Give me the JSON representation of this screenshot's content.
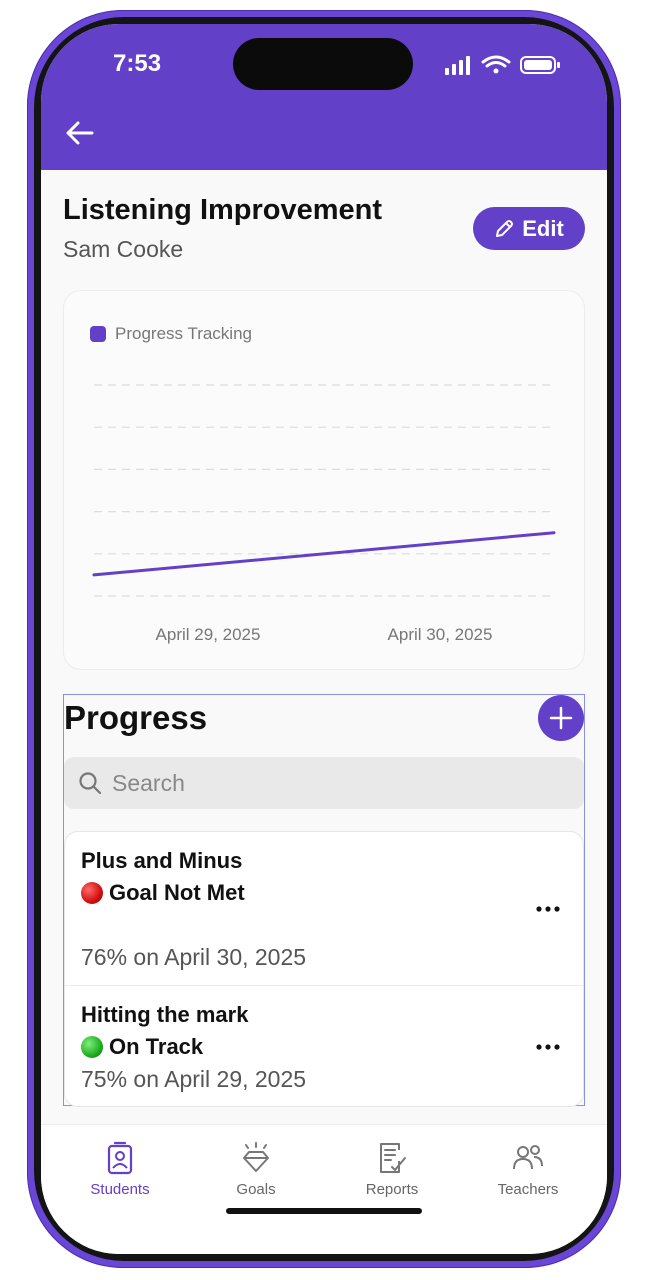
{
  "status_bar": {
    "time": "7:53"
  },
  "header": {
    "back_icon": "arrow-left-icon"
  },
  "goal": {
    "title": "Listening Improvement",
    "student": "Sam Cooke",
    "edit_label": "Edit"
  },
  "chart_data": {
    "type": "line",
    "legend": "Progress Tracking",
    "x": [
      "April 29, 2025",
      "April 30, 2025"
    ],
    "series": [
      {
        "name": "Progress Tracking",
        "values": [
          75,
          76
        ]
      }
    ],
    "grid": true,
    "legend_position": "top-left",
    "color": "#6340c8"
  },
  "progress": {
    "heading": "Progress",
    "search_placeholder": "Search",
    "items": [
      {
        "title": "Plus and Minus",
        "status": "Goal Not Met",
        "status_color": "red",
        "meta": "76% on April 30, 2025"
      },
      {
        "title": "Hitting the mark",
        "status": "On Track",
        "status_color": "green",
        "meta": "75% on April 29, 2025"
      }
    ]
  },
  "tabs": [
    {
      "label": "Students",
      "icon": "student-badge-icon",
      "active": true
    },
    {
      "label": "Goals",
      "icon": "diamond-icon",
      "active": false
    },
    {
      "label": "Reports",
      "icon": "report-icon",
      "active": false
    },
    {
      "label": "Teachers",
      "icon": "people-icon",
      "active": false
    }
  ],
  "colors": {
    "accent": "#6340c8",
    "frame": "#6a46d6"
  }
}
